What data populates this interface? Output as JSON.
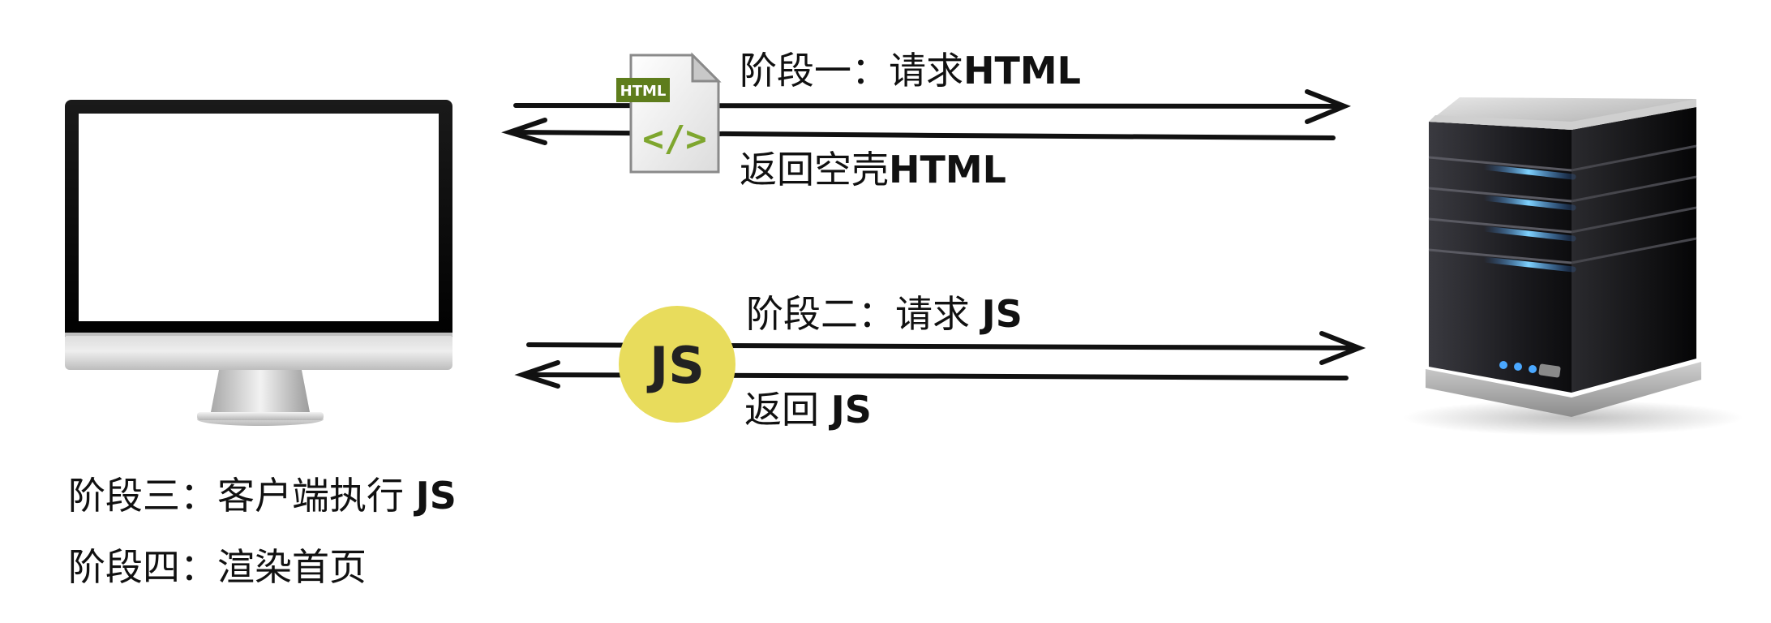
{
  "stages": {
    "stage1": {
      "prefix": "阶段一：",
      "text": "请求",
      "code": "HTML"
    },
    "return_html": {
      "text": "返回空壳",
      "code": "HTML"
    },
    "stage2": {
      "prefix": "阶段二：",
      "text": "请求 ",
      "code": "JS"
    },
    "return_js": {
      "text": "返回 ",
      "code": "JS"
    },
    "stage3": {
      "prefix": "阶段三：",
      "text": "客户端执行 ",
      "code": "JS"
    },
    "stage4": {
      "prefix": "阶段四：",
      "text": "渲染首页"
    }
  },
  "icons": {
    "html_file": {
      "badge": "HTML",
      "glyph": "</>",
      "badge_color": "#5e7d1c",
      "glyph_color": "#7ea62e"
    },
    "js_badge": {
      "text": "JS",
      "fill": "#e8dc5c"
    }
  },
  "colors": {
    "arrow": "#111111"
  }
}
